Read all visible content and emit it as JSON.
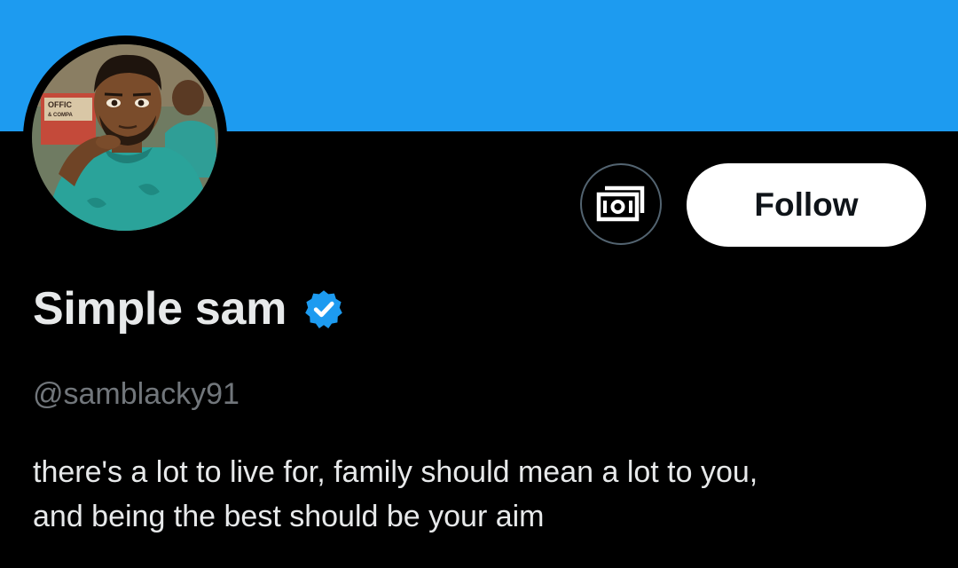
{
  "profile": {
    "display_name": "Simple sam",
    "handle": "@samblacky91",
    "bio_lines": [
      "there's a lot to live for, family should mean a lot to you,",
      "and being the best should be your aim"
    ],
    "verified": true
  },
  "actions": {
    "tip_icon": "money-tip-icon",
    "follow_label": "Follow"
  },
  "avatar": {
    "sign_text_1": "OFFIC",
    "sign_text_2": "& COMPA"
  },
  "colors": {
    "banner": "#1d9bf0",
    "background": "#000000",
    "verified_badge": "#1d9bf0",
    "name_text": "#e7e9ea",
    "handle_text": "#71767b",
    "follow_bg": "#ffffff",
    "follow_text": "#0f1419",
    "tip_border": "#536471"
  }
}
